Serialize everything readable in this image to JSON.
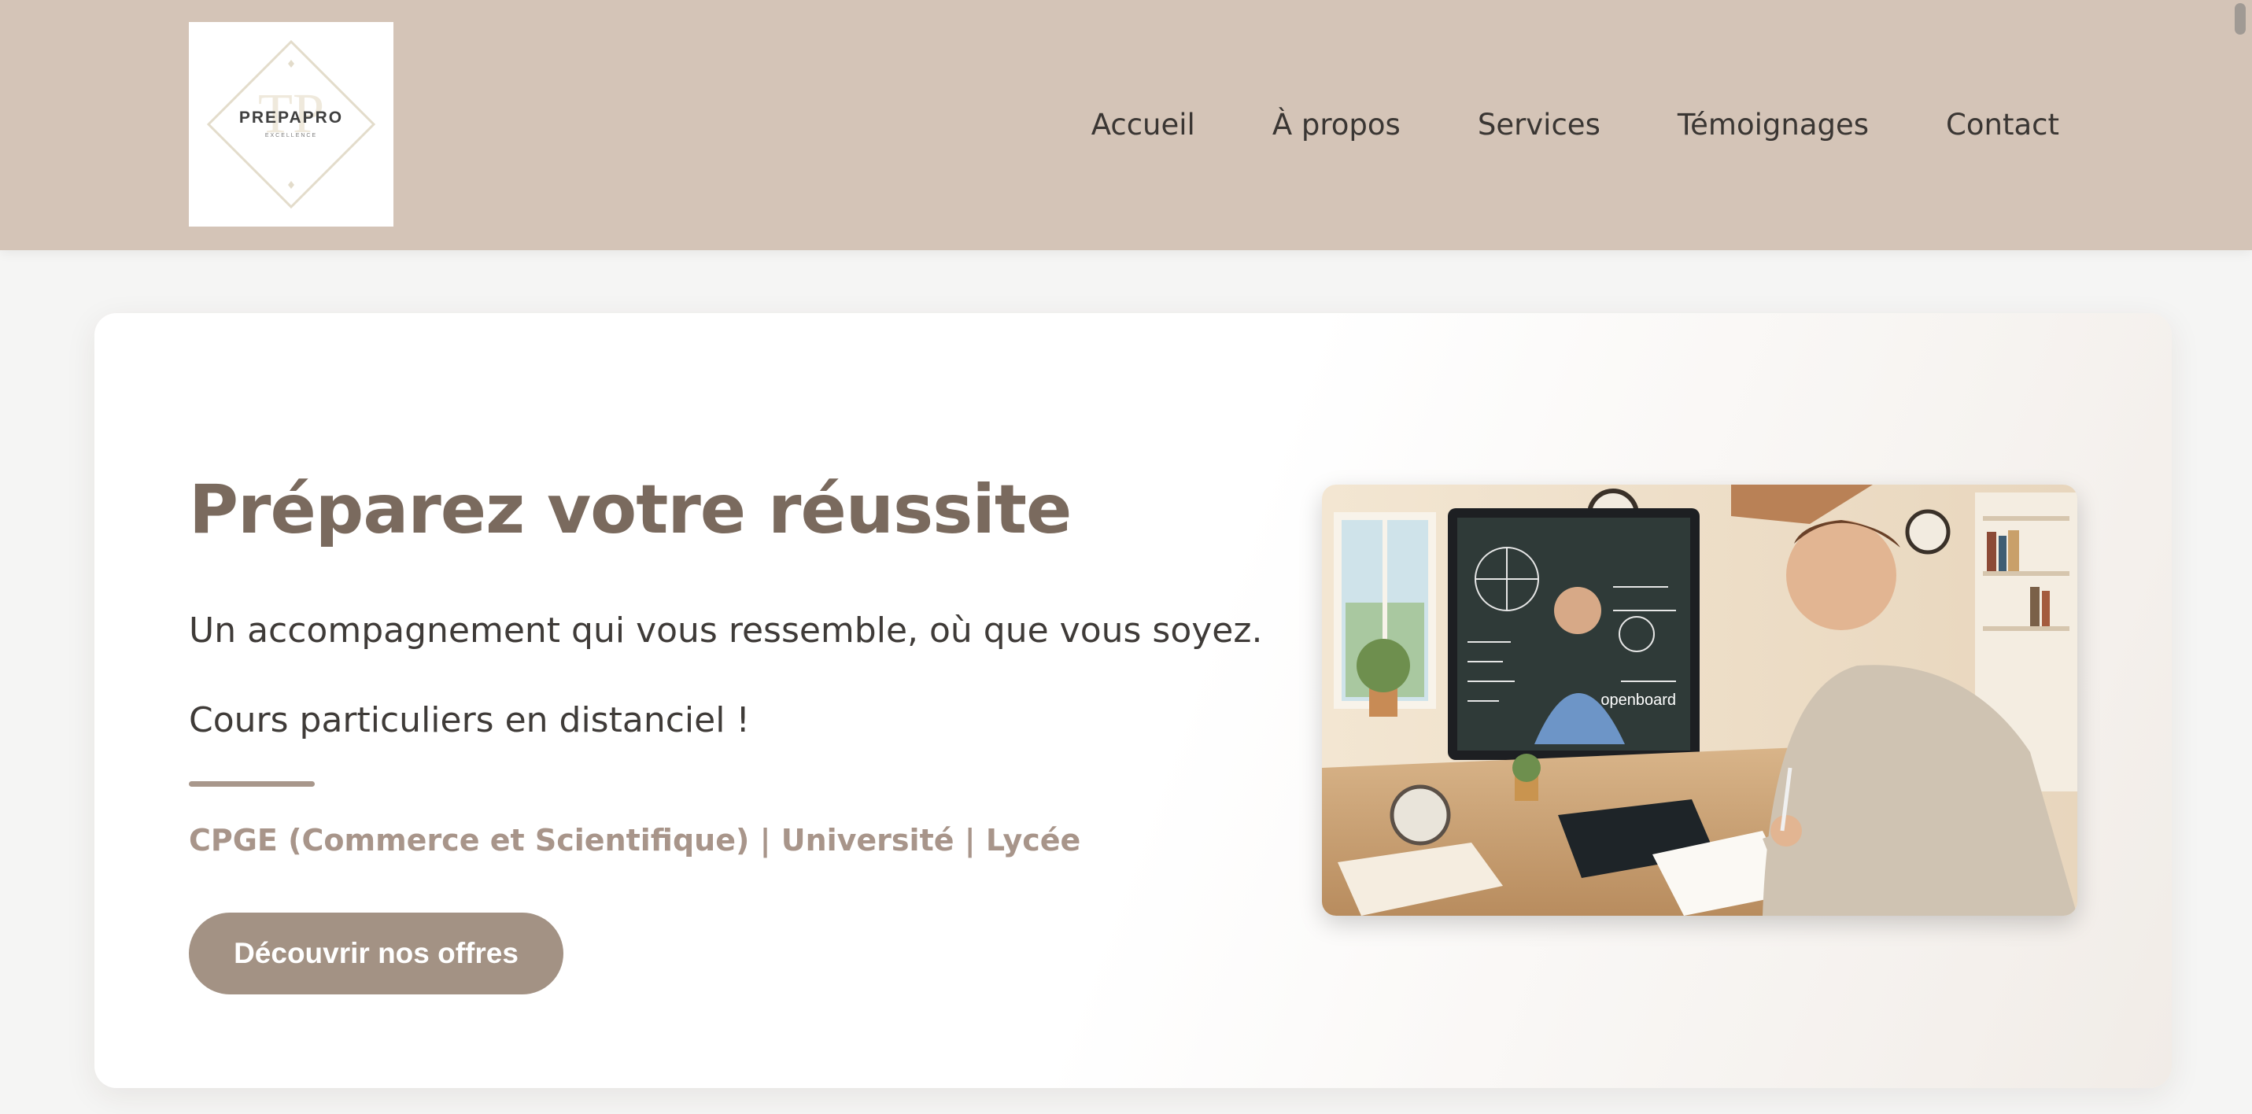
{
  "brand": {
    "logo_text": "PREPAPRO",
    "logo_tagline": "EXCELLENCE",
    "logo_monogram": "TP"
  },
  "nav": {
    "items": [
      {
        "label": "Accueil"
      },
      {
        "label": "À propos"
      },
      {
        "label": "Services"
      },
      {
        "label": "Témoignages"
      },
      {
        "label": "Contact"
      }
    ]
  },
  "hero": {
    "title": "Préparez votre réussite",
    "subtitle": "Un accompagnement qui vous ressemble, où que vous soyez.",
    "subtitle2": "Cours particuliers en distanciel !",
    "levels": "CPGE (Commerce et Scientifique) | Université | Lycée",
    "cta_label": "Découvrir nos offres",
    "image_screen_text": "openboard"
  },
  "colors": {
    "header_bg": "#d4c4b7",
    "accent": "#7a6a5e",
    "button_bg": "#a39284",
    "levels_text": "#a8958a"
  }
}
